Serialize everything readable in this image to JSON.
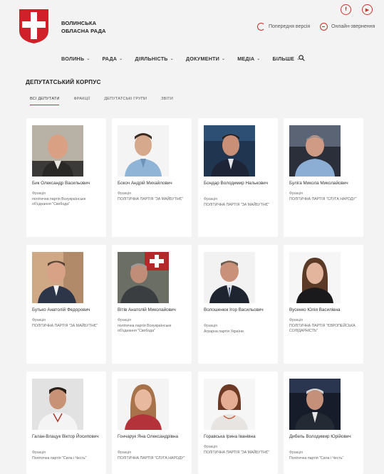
{
  "header": {
    "org_name_line1": "Волинська",
    "org_name_line2": "обласна рада",
    "prev_version": "Попередня версія",
    "live_stream": "Онлайн-звернення",
    "social": {
      "facebook": "f",
      "youtube": "▶"
    }
  },
  "nav": [
    {
      "label": "Волинь"
    },
    {
      "label": "Рада"
    },
    {
      "label": "Діяльність"
    },
    {
      "label": "Документи"
    },
    {
      "label": "Медіа"
    },
    {
      "label": "Більше"
    }
  ],
  "page": {
    "title": "Депутатський корпус",
    "tabs": [
      "Всі депутати",
      "Фракції",
      "Депутатські групи",
      "Звіти"
    ]
  },
  "fraction_label": "Фракція",
  "deputies": [
    {
      "name": "Бик Олександр Васильович",
      "party": "політична партія Всеукраїнське об'єднання \"Свобода\""
    },
    {
      "name": "Бокоч Андрій Михайлович",
      "party": "ПОЛІТИЧНА ПАРТІЯ \"ЗА МАЙБУТНЄ\""
    },
    {
      "name": "Бондар Володимир Налькович",
      "party": "ПОЛІТИЧНА ПАРТІЯ \"ЗА МАЙБУТНЄ\""
    },
    {
      "name": "Буліга Микола Миколайович",
      "party": "ПОЛІТИЧНА ПАРТІЯ \"СЛУГА НАРОДУ\""
    },
    {
      "name": "Бутько Анатолій Федорович",
      "party": "ПОЛІТИЧНА ПАРТІЯ \"ЗА МАЙБУТНЄ\""
    },
    {
      "name": "Вітів Анатолій Миколайович",
      "party": "політична партія Всеукраїнське об'єднання \"Свобода\""
    },
    {
      "name": "Волошенюк Ігор Васильович",
      "party": "Аграрна партія України"
    },
    {
      "name": "Вусенко Юлія Василівна",
      "party": "ПОЛІТИЧНА ПАРТІЯ \"ЄВРОПЕЙСЬКА СОЛІДАРНІСТЬ\""
    },
    {
      "name": "Галан-Влацук Віктор Йосипович",
      "party": "Політична партія \"Сила і Честь\""
    },
    {
      "name": "Гончарук Яна Олександрівна",
      "party": "ПОЛІТИЧНА ПАРТІЯ \"СЛУГА НАРОДУ\""
    },
    {
      "name": "Горавська Ірина Іванівна",
      "party": "ПОЛІТИЧНА ПАРТІЯ \"ЗА МАЙБУТНЄ\""
    },
    {
      "name": "Дибель Володимир Юрійович",
      "party": "Політична партія \"Сила і Честь\""
    }
  ],
  "colors": {
    "accent": "#c0392b",
    "background": "#f3f3f3",
    "card": "#ffffff"
  }
}
